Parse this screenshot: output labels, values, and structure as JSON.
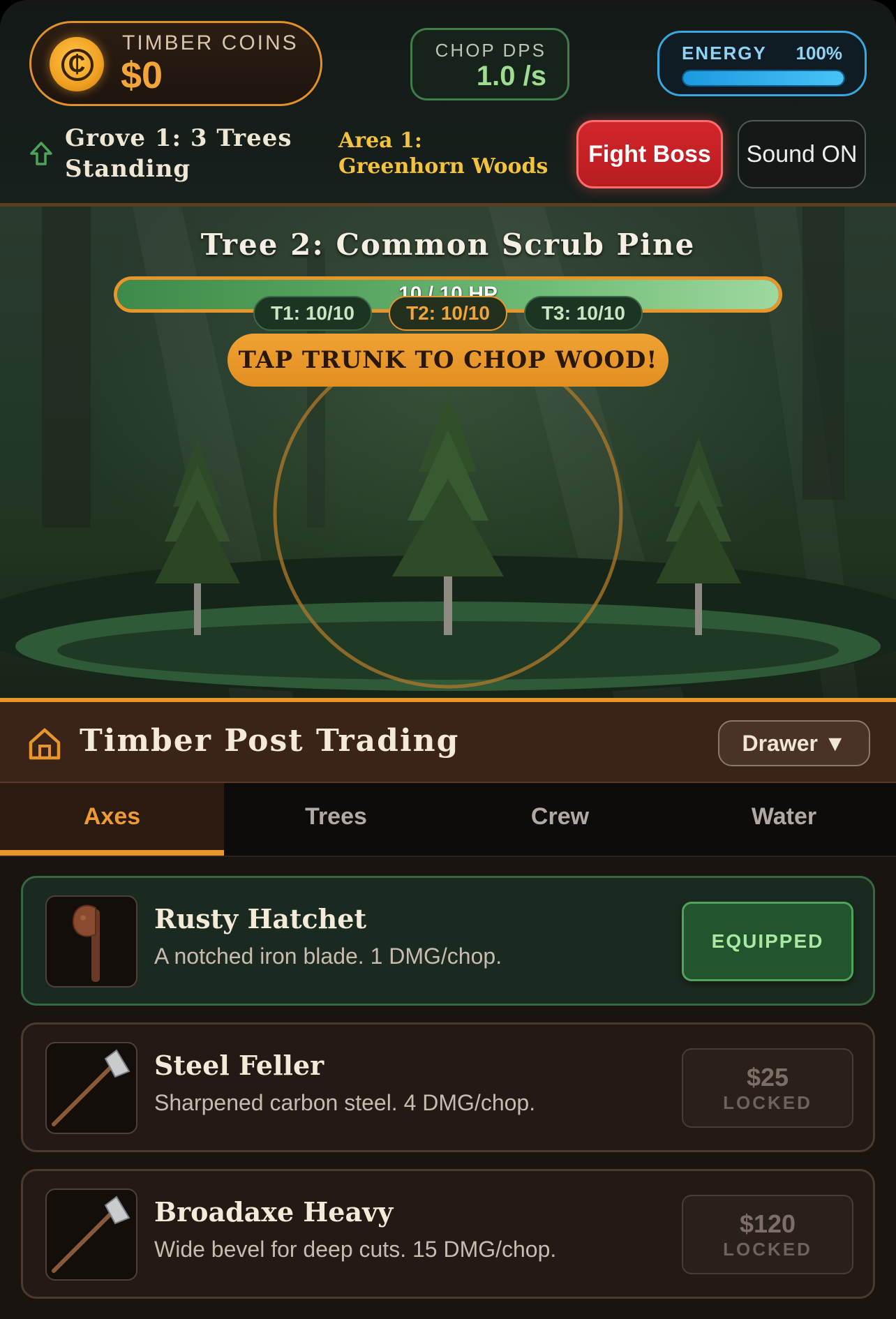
{
  "hud": {
    "coins_label": "TIMBER COINS",
    "coins_value": "$0",
    "coin_symbol": "₵",
    "dps_label": "CHOP DPS",
    "dps_value": "1.0 /s",
    "energy_label": "ENERGY",
    "energy_percent_text": "100%",
    "energy_fraction": 1.0,
    "grove_text": "Grove 1: 3 Trees Standing",
    "area_text": "Area 1: Greenhorn Woods",
    "fight_boss_label": "Fight Boss",
    "sound_label": "Sound ON"
  },
  "forest": {
    "tree_title": "Tree 2: Common Scrub Pine",
    "hp_text": "10 / 10 HP",
    "hp_fraction": 1.0,
    "tree_chips": [
      "T1: 10/10",
      "T2: 10/10",
      "T3: 10/10"
    ],
    "active_chip": 1,
    "tap_banner": "TAP TRUNK TO CHOP WOOD!"
  },
  "shop": {
    "title": "Timber Post Trading",
    "drawer_label": "Drawer ▼",
    "tabs": [
      "Axes",
      "Trees",
      "Crew",
      "Water"
    ],
    "active_tab": 0,
    "items": [
      {
        "name": "Rusty Hatchet",
        "desc": "A notched iron blade. 1 DMG/chop.",
        "action_main": "",
        "action_sub": "EQUIPPED",
        "icon": "rusty-hatchet-icon"
      },
      {
        "name": "Steel Feller",
        "desc": "Sharpened carbon steel. 4 DMG/chop.",
        "action_main": "$25",
        "action_sub": "LOCKED",
        "icon": "steel-axe-icon"
      },
      {
        "name": "Broadaxe Heavy",
        "desc": "Wide bevel for deep cuts. 15 DMG/chop.",
        "action_main": "$120",
        "action_sub": "LOCKED",
        "icon": "broadaxe-icon"
      }
    ]
  },
  "colors": {
    "accent": "#e8962a",
    "equipped": "#22542d",
    "danger": "#d3262b",
    "energy": "#49c2f6"
  }
}
